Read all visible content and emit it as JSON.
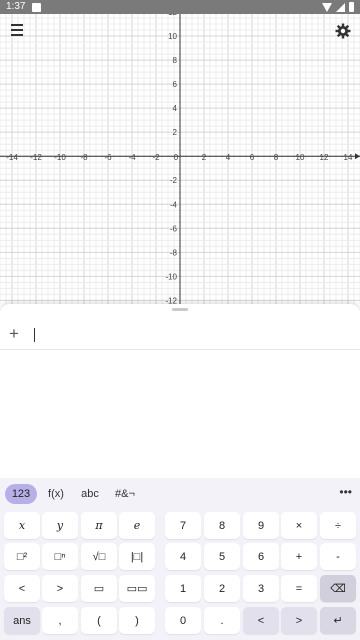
{
  "status_bar": {
    "time": "1:37"
  },
  "graph": {
    "x_ticks": [
      "-14",
      "-12",
      "-10",
      "-8",
      "-6",
      "-4",
      "-2",
      "0",
      "2",
      "4",
      "6",
      "8",
      "10",
      "12",
      "14"
    ],
    "y_ticks_pos": [
      "12",
      "10",
      "8",
      "6",
      "4",
      "2"
    ],
    "y_ticks_neg": [
      "-2",
      "-4",
      "-6",
      "-8",
      "-10",
      "-12"
    ],
    "x_range": [
      -15,
      15
    ],
    "y_range": [
      -12.3,
      13
    ]
  },
  "algebra": {
    "add_label": "+",
    "input_value": ""
  },
  "keyboard": {
    "tabs": [
      "123",
      "f(x)",
      "abc",
      "#&¬"
    ],
    "active_tab": "123",
    "more_label": "•••",
    "left_rows": [
      [
        "x",
        "y",
        "π",
        "e"
      ],
      [
        "□²",
        "□ⁿ",
        "√□",
        "|□|"
      ],
      [
        "<",
        ">",
        "▭",
        "▭▭"
      ],
      [
        "ans",
        ",",
        "(",
        ")"
      ]
    ],
    "right_rows": [
      [
        "7",
        "8",
        "9",
        "×",
        "÷"
      ],
      [
        "4",
        "5",
        "6",
        "+",
        "-"
      ],
      [
        "1",
        "2",
        "3",
        "=",
        "⌫"
      ],
      [
        "0",
        ".",
        "<",
        ">",
        "↵"
      ]
    ]
  }
}
